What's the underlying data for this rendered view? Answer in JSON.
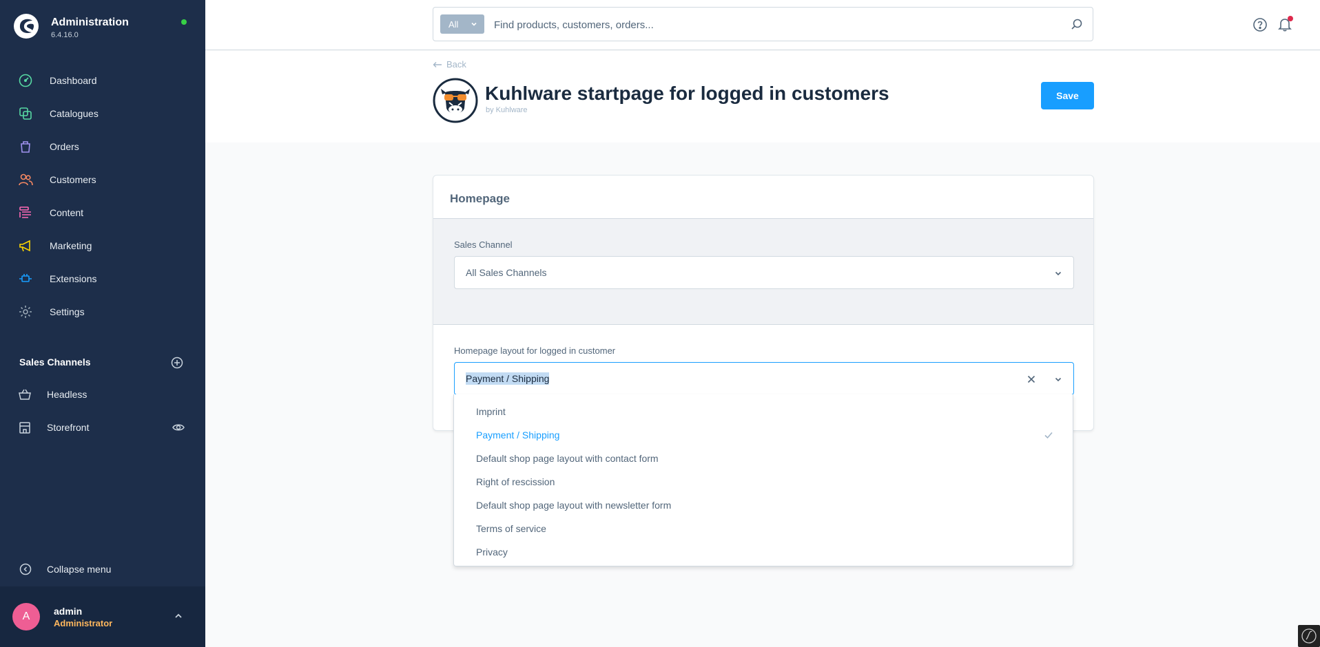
{
  "app": {
    "title": "Administration",
    "version": "6.4.16.0"
  },
  "nav": [
    {
      "label": "Dashboard",
      "icon": "dashboard-icon",
      "color": "#57d9a3"
    },
    {
      "label": "Catalogues",
      "icon": "catalogue-icon",
      "color": "#57d9a3"
    },
    {
      "label": "Orders",
      "icon": "orders-icon",
      "color": "#a092f0"
    },
    {
      "label": "Customers",
      "icon": "customers-icon",
      "color": "#f88962"
    },
    {
      "label": "Content",
      "icon": "content-icon",
      "color": "#ff68b4"
    },
    {
      "label": "Marketing",
      "icon": "marketing-icon",
      "color": "#ffd700"
    },
    {
      "label": "Extensions",
      "icon": "extensions-icon",
      "color": "#189eff"
    },
    {
      "label": "Settings",
      "icon": "settings-icon",
      "color": "#9aa8b5"
    }
  ],
  "sales_channels": {
    "heading": "Sales Channels",
    "items": [
      {
        "label": "Headless",
        "icon": "basket-icon"
      },
      {
        "label": "Storefront",
        "icon": "storefront-icon"
      }
    ]
  },
  "sidebar_footer": {
    "collapse_label": "Collapse menu",
    "user_initial": "A",
    "user_name": "admin",
    "user_role": "Administrator"
  },
  "search": {
    "type_label": "All",
    "placeholder": "Find products, customers, orders..."
  },
  "header": {
    "back_label": "Back",
    "title": "Kuhlware startpage for logged in customers",
    "by_line": "by Kuhlware",
    "save_label": "Save"
  },
  "card": {
    "title": "Homepage",
    "sales_channel_label": "Sales Channel",
    "sales_channel_value": "All Sales Channels",
    "layout_label": "Homepage layout for logged in customer",
    "layout_value": "Payment / Shipping"
  },
  "dropdown": {
    "options": [
      {
        "label": "Imprint",
        "selected": false
      },
      {
        "label": "Payment / Shipping",
        "selected": true
      },
      {
        "label": "Default shop page layout with contact form",
        "selected": false
      },
      {
        "label": "Right of rescission",
        "selected": false
      },
      {
        "label": "Default shop page layout with newsletter form",
        "selected": false
      },
      {
        "label": "Terms of service",
        "selected": false
      },
      {
        "label": "Privacy",
        "selected": false
      }
    ]
  },
  "colors": {
    "sidebar_bg": "#1d2e4a",
    "accent": "#189eff",
    "status_ok": "#37d046",
    "avatar": "#ee5e94",
    "role": "#ffb75d"
  }
}
